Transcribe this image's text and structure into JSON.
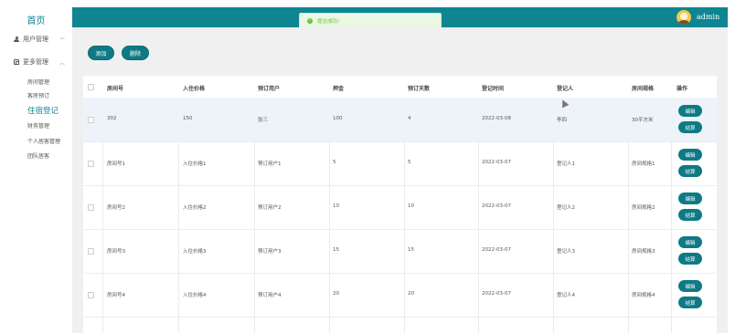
{
  "sidebar": {
    "home": "首页",
    "user_mgmt": "用户管理",
    "more_mgmt": "更多管理",
    "sub_items": [
      "房间管理",
      "客房预订",
      "住宿登记",
      "财务管理",
      "个人居客管理",
      "团队居客"
    ],
    "active_item": "住宿登记"
  },
  "header": {
    "toast": "提交成功!",
    "username": "admin",
    "bar_color": "#0e8591"
  },
  "toolbar": {
    "add_label": "添加",
    "delete_label": "删除"
  },
  "table": {
    "columns": [
      "房间号",
      "入住价格",
      "预订用户",
      "押金",
      "预订天数",
      "登记时间",
      "登记人",
      "房间规格",
      "操作"
    ],
    "rows": [
      [
        "302",
        "150",
        "张三",
        "100",
        "4",
        "2022-03-08",
        "李四",
        "30平方米"
      ],
      [
        "房间号1",
        "入住价格1",
        "预订用户1",
        "5",
        "5",
        "2022-03-07",
        "登记人1",
        "房间规格1"
      ],
      [
        "房间号2",
        "入住价格2",
        "预订用户2",
        "10",
        "10",
        "2022-03-07",
        "登记人2",
        "房间规格2"
      ],
      [
        "房间号3",
        "入住价格3",
        "预订用户3",
        "15",
        "15",
        "2022-03-07",
        "登记人3",
        "房间规格3"
      ],
      [
        "房间号4",
        "入住价格4",
        "预订用户4",
        "20",
        "20",
        "2022-03-07",
        "登记人4",
        "房间规格4"
      ]
    ],
    "edit_label": "编辑",
    "settle_label": "结算"
  }
}
